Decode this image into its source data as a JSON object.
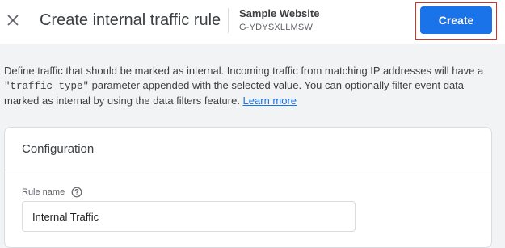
{
  "header": {
    "close_icon": "close-icon",
    "title": "Create internal traffic rule",
    "property_name": "Sample Website",
    "property_id": "G-YDYSXLLMSW",
    "create_label": "Create"
  },
  "description": {
    "text_1": "Define traffic that should be marked as internal. Incoming traffic from matching IP addresses will have a ",
    "code": "\"traffic_type\"",
    "text_2": " parameter appended with the selected value. You can optionally filter event data marked as internal by using the data filters feature. ",
    "link": "Learn more"
  },
  "configuration": {
    "title": "Configuration",
    "rule_name_label": "Rule name",
    "help_icon": "help-circle-icon",
    "rule_name_value": "Internal Traffic"
  },
  "colors": {
    "primary": "#1a73e8",
    "highlight": "#d93025",
    "background": "#f1f3f4"
  }
}
